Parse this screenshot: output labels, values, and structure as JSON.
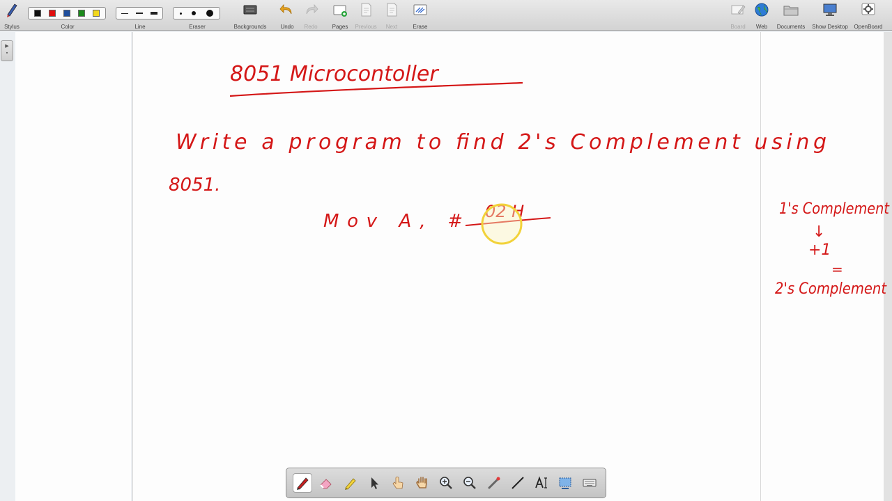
{
  "toolbar": {
    "stylus": "Stylus",
    "color": "Color",
    "line": "Line",
    "eraser": "Eraser",
    "backgrounds": "Backgrounds",
    "undo": "Undo",
    "redo": "Redo",
    "pages": "Pages",
    "previous": "Previous",
    "next": "Next",
    "erase": "Erase",
    "board": "Board",
    "web": "Web",
    "documents": "Documents",
    "show_desktop": "Show Desktop",
    "openboard": "OpenBoard"
  },
  "colors": {
    "swatches": [
      "#111111",
      "#e01010",
      "#1f4e9c",
      "#1b8a1b",
      "#f3d81c"
    ],
    "ink": "#d41717",
    "pointer_highlight": "#f2d23a"
  },
  "board": {
    "title": "8051 Microcontoller",
    "question_line1": "Write a program to find 2's Complement using",
    "question_line2": "8051.",
    "code_instruction": "Mov A, #",
    "code_operand": "02 H",
    "note_ones": "1's Complement",
    "note_arrow": "↓",
    "note_plus": "+1",
    "note_equals": "=",
    "note_twos": "2's Complement"
  },
  "bottom_tools": [
    "pen-tool",
    "eraser-tool",
    "highlighter-tool",
    "selector-tool",
    "interact-tool",
    "hand-tool",
    "zoom-in-tool",
    "zoom-out-tool",
    "laser-pointer-tool",
    "line-tool",
    "text-tool",
    "capture-tool",
    "keyboard-tool"
  ]
}
